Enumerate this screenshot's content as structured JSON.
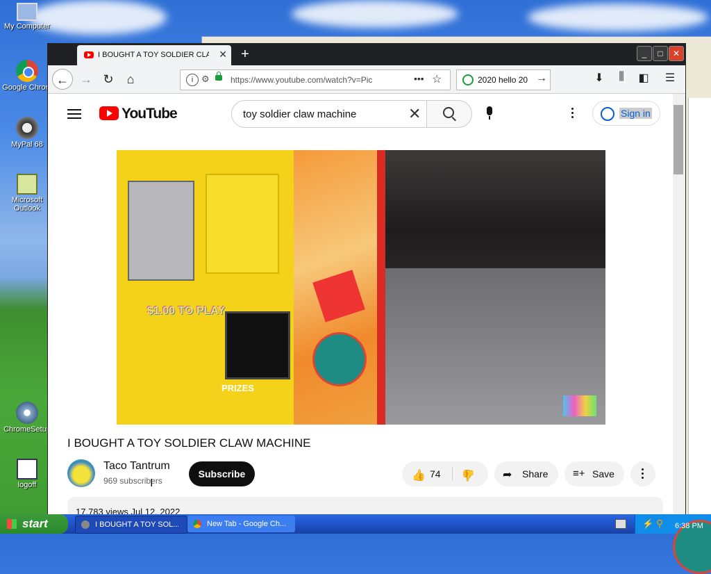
{
  "desktop": {
    "icons": [
      {
        "label": "My Computer"
      },
      {
        "label": "Google Chrom"
      },
      {
        "label": "MyPal 68"
      },
      {
        "label": "Microsoft Outlook"
      },
      {
        "label": "ChromeSetup"
      },
      {
        "label": "logoff"
      }
    ]
  },
  "browser": {
    "tab_title": "I BOUGHT A TOY SOLDIER CLAW MACHINE",
    "new_tab": "+",
    "url": "https://www.youtube.com/watch?v=Pic",
    "search_text": "2020 hello 20",
    "window_buttons": {
      "minimize": "_",
      "maximize": "□",
      "close": "✕"
    }
  },
  "youtube": {
    "logo_text": "YouTube",
    "search_value": "toy soldier claw machine",
    "sign_in": "Sign in",
    "video_title": "I BOUGHT A TOY SOLDIER CLAW MACHINE",
    "channel_name": "Taco Tantrum",
    "subscribers": "969 subscribers",
    "subscribe_label": "Subscribe",
    "likes": "74",
    "share_label": "Share",
    "save_label": "Save",
    "views_date": "17,783 views  Jul 12, 2022",
    "video_text": {
      "price_badge": "$1.00 TO PLAY",
      "prizes": "PRIZES"
    }
  },
  "taskbar": {
    "start_label": "start",
    "tasks": [
      {
        "label": "I BOUGHT A TOY SOL..."
      },
      {
        "label": "New Tab - Google Ch..."
      }
    ],
    "clock": "6:38 PM"
  }
}
